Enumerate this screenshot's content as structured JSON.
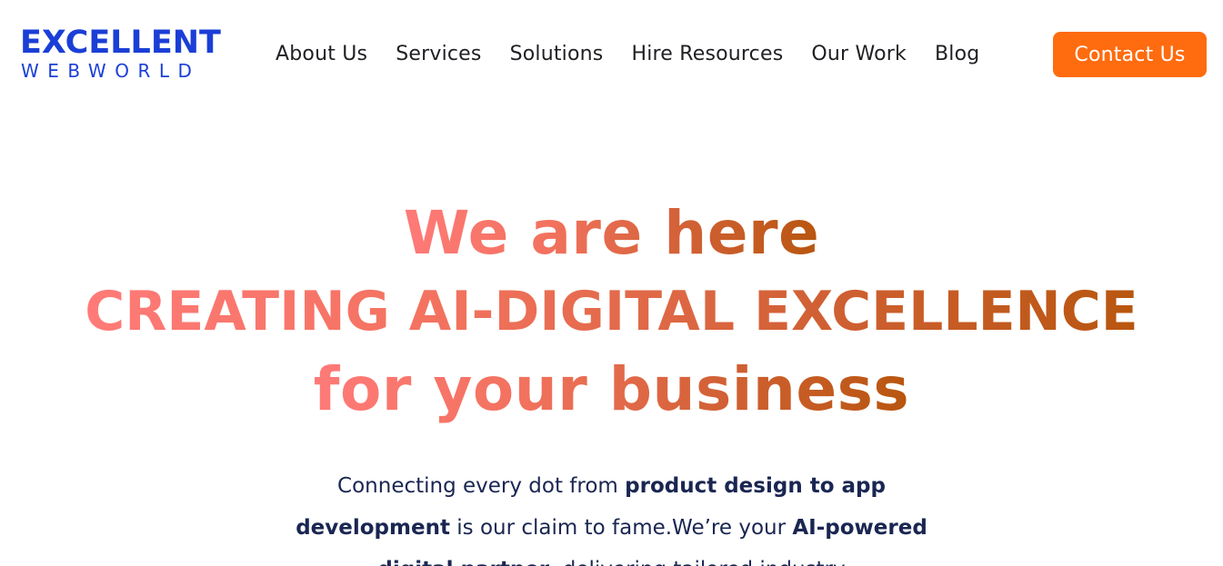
{
  "brand": {
    "logo_top": "EXCELLENT",
    "logo_bottom": "WEBWORLD",
    "color": "#1b3fd6"
  },
  "nav": {
    "items": [
      {
        "label": "About Us"
      },
      {
        "label": "Services"
      },
      {
        "label": "Solutions"
      },
      {
        "label": "Hire Resources"
      },
      {
        "label": "Our Work"
      },
      {
        "label": "Blog"
      }
    ],
    "cta_label": "Contact Us",
    "cta_color": "#ff6b0f"
  },
  "hero": {
    "line1": "We are here",
    "line2": "CREATING AI-DIGITAL EXCELLENCE",
    "line3": "for your business",
    "gradient_colors": [
      "#ff7a78",
      "#b8560f"
    ]
  },
  "intro": {
    "p1": "Connecting every dot from ",
    "b1": "product design to app development",
    "p2": " is our claim to fame.We’re your ",
    "b2": "AI-powered digital partner",
    "p3": ", delivering tailored industry"
  }
}
